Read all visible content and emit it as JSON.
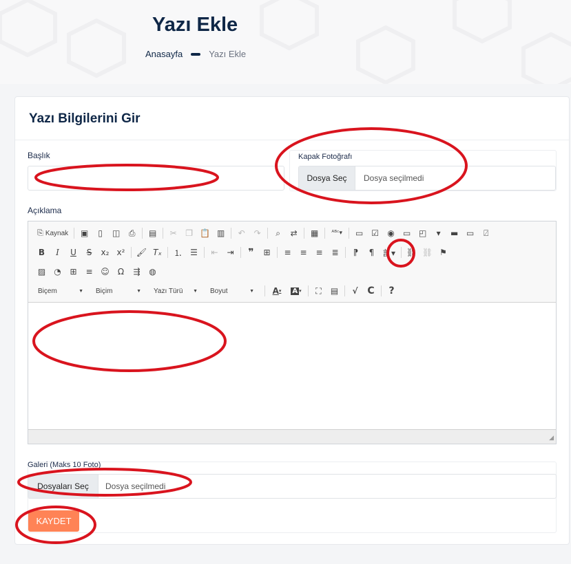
{
  "header": {
    "title": "Yazı Ekle",
    "breadcrumb": {
      "home": "Anasayfa",
      "current": "Yazı Ekle"
    }
  },
  "form": {
    "section_title": "Yazı Bilgilerini Gir",
    "title_label": "Başlık",
    "title_value": "",
    "cover_label": "Kapak Fotoğrafı",
    "cover_button": "Dosya Seç",
    "cover_status": "Dosya seçilmedi",
    "description_label": "Açıklama",
    "gallery_label": "Galeri (Maks 10 Foto)",
    "gallery_button": "Dosyaları Seç",
    "gallery_status": "Dosya seçilmedi",
    "submit_label": "KAYDET"
  },
  "editor": {
    "source_label": "Kaynak",
    "combos": [
      "Biçem",
      "Biçim",
      "Yazı Türü",
      "Boyut"
    ],
    "text_color_label": "A",
    "bg_color_label": "A",
    "help_label": "?"
  },
  "colors": {
    "brand": "#0f2747",
    "submit": "#ff8356",
    "annotation": "#d9141e"
  }
}
